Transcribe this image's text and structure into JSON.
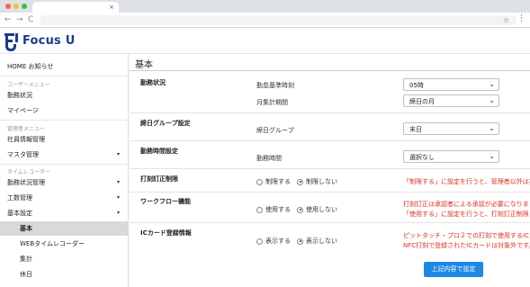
{
  "browser": {
    "tab_close": "×",
    "nav_back": "←",
    "nav_forward": "→",
    "nav_reload": "C",
    "star": "☆",
    "menu": "⋮"
  },
  "app": {
    "logo_text": "Focus U",
    "brand_color": "#1c3b8a"
  },
  "sidebar": {
    "home": "HOME お知らせ",
    "section_user": "ユーザーメニュー",
    "attendance_status": "勤務状況",
    "mypage": "マイページ",
    "section_admin": "管理者メニュー",
    "employee_info": "社員情報管理",
    "master_mgmt": "マスタ管理",
    "section_timerecorder": "タイムレコーダー",
    "attendance_mgmt": "勤務状況管理",
    "work_mgmt": "工数管理",
    "basic_settings": "基本設定",
    "sub_items": {
      "basic": "基本",
      "web_recorder": "WEBタイムレコーダー",
      "aggregate": "集計",
      "holiday": "休日"
    },
    "caret": "▾"
  },
  "main": {
    "title": "基本",
    "sections": {
      "attendance": {
        "head": "勤務状況",
        "rows": [
          {
            "label": "勤怠基準時刻",
            "value": "05時"
          },
          {
            "label": "月集計期間",
            "value": "締日の月"
          }
        ]
      },
      "closing_group": {
        "head": "締日グループ設定",
        "rows": [
          {
            "label": "締日グループ",
            "value": "末日"
          }
        ]
      },
      "work_time": {
        "head": "勤務時間設定",
        "rows": [
          {
            "label": "勤務時間",
            "value": "選択なし"
          }
        ]
      },
      "stamp_fix": {
        "head": "打刻訂正制限",
        "option_a": "制限する",
        "option_b": "制限しない",
        "selected": "制限しない",
        "note": "「制限する」に設定を行うと、管理者以外は打"
      },
      "workflow": {
        "head": "ワークフロー機能",
        "option_a": "使用する",
        "option_b": "使用しない",
        "selected": "使用しない",
        "note_1": "打刻訂正は承認者による承認が必要になりま",
        "note_2": "「使用する」に設定を行うと、打刻訂正制限"
      },
      "ic_card": {
        "head": "ICカード登録情報",
        "option_a": "表示する",
        "option_b": "表示しない",
        "selected": "表示しない",
        "note_1": "ピットタッチ・プロ２での打刻で使用するICカ",
        "note_2": "NFC打刻で登録されたICカードは対象外です。"
      }
    },
    "select_caret": "⌄",
    "save_button": "上記内容で設定",
    "note_color": "#e0301e",
    "button_color": "#1e88e5"
  }
}
